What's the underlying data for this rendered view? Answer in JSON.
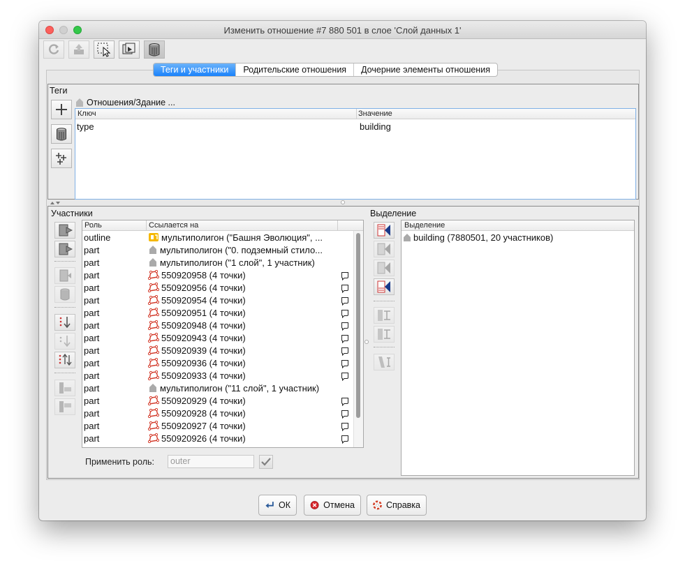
{
  "window": {
    "title": "Изменить отношение #7 880 501 в слое 'Слой данных 1'"
  },
  "toolbar": [
    "refresh-icon",
    "upload-icon",
    "select-icon",
    "zoom-icon",
    "delete-icon"
  ],
  "tabs": [
    {
      "label": "Теги и участники",
      "active": true
    },
    {
      "label": "Родительские отношения",
      "active": false
    },
    {
      "label": "Дочерние элементы отношения",
      "active": false
    }
  ],
  "tags": {
    "label": "Теги",
    "preset": "Отношения/Здание ...",
    "columns": {
      "key": "Ключ",
      "value": "Значение"
    },
    "rows": [
      {
        "key": "type",
        "value": "building"
      }
    ]
  },
  "members": {
    "label": "Участники",
    "columns": {
      "role": "Роль",
      "ref": "Ссылается на"
    },
    "rows": [
      {
        "role": "outline",
        "icon": "multipolygon-yellow",
        "ref": "мультиполигон (\"Башня Эволюция\", ...",
        "note": false
      },
      {
        "role": "part",
        "icon": "building",
        "ref": "мультиполигон (\"0. подземный стило...",
        "note": false
      },
      {
        "role": "part",
        "icon": "building",
        "ref": "мультиполигон (\"1 слой\", 1 участник)",
        "note": false
      },
      {
        "role": "part",
        "icon": "way",
        "ref": "550920958 (4 точки)",
        "note": true
      },
      {
        "role": "part",
        "icon": "way",
        "ref": "550920956 (4 точки)",
        "note": true
      },
      {
        "role": "part",
        "icon": "way",
        "ref": "550920954 (4 точки)",
        "note": true
      },
      {
        "role": "part",
        "icon": "way",
        "ref": "550920951 (4 точки)",
        "note": true
      },
      {
        "role": "part",
        "icon": "way",
        "ref": "550920948 (4 точки)",
        "note": true
      },
      {
        "role": "part",
        "icon": "way",
        "ref": "550920943 (4 точки)",
        "note": true
      },
      {
        "role": "part",
        "icon": "way",
        "ref": "550920939 (4 точки)",
        "note": true
      },
      {
        "role": "part",
        "icon": "way",
        "ref": "550920936 (4 точки)",
        "note": true
      },
      {
        "role": "part",
        "icon": "way",
        "ref": "550920933 (4 точки)",
        "note": true
      },
      {
        "role": "part",
        "icon": "building",
        "ref": "мультиполигон (\"11 слой\", 1 участник)",
        "note": false
      },
      {
        "role": "part",
        "icon": "way",
        "ref": "550920929 (4 точки)",
        "note": true
      },
      {
        "role": "part",
        "icon": "way",
        "ref": "550920928 (4 точки)",
        "note": true
      },
      {
        "role": "part",
        "icon": "way",
        "ref": "550920927 (4 точки)",
        "note": true
      },
      {
        "role": "part",
        "icon": "way",
        "ref": "550920926 (4 точки)",
        "note": true
      }
    ],
    "apply_role_label": "Применить роль:",
    "apply_role_value": "outer"
  },
  "selection": {
    "label": "Выделение",
    "column": "Выделение",
    "rows": [
      {
        "icon": "building",
        "text": "building (7880501, 20 участников)"
      }
    ]
  },
  "buttons": {
    "ok": "ОК",
    "cancel": "Отмена",
    "help": "Справка"
  },
  "colors": {
    "accent": "#1a82fb",
    "way_icon": "#d33a2a",
    "multipolygon": "#f5b800"
  }
}
